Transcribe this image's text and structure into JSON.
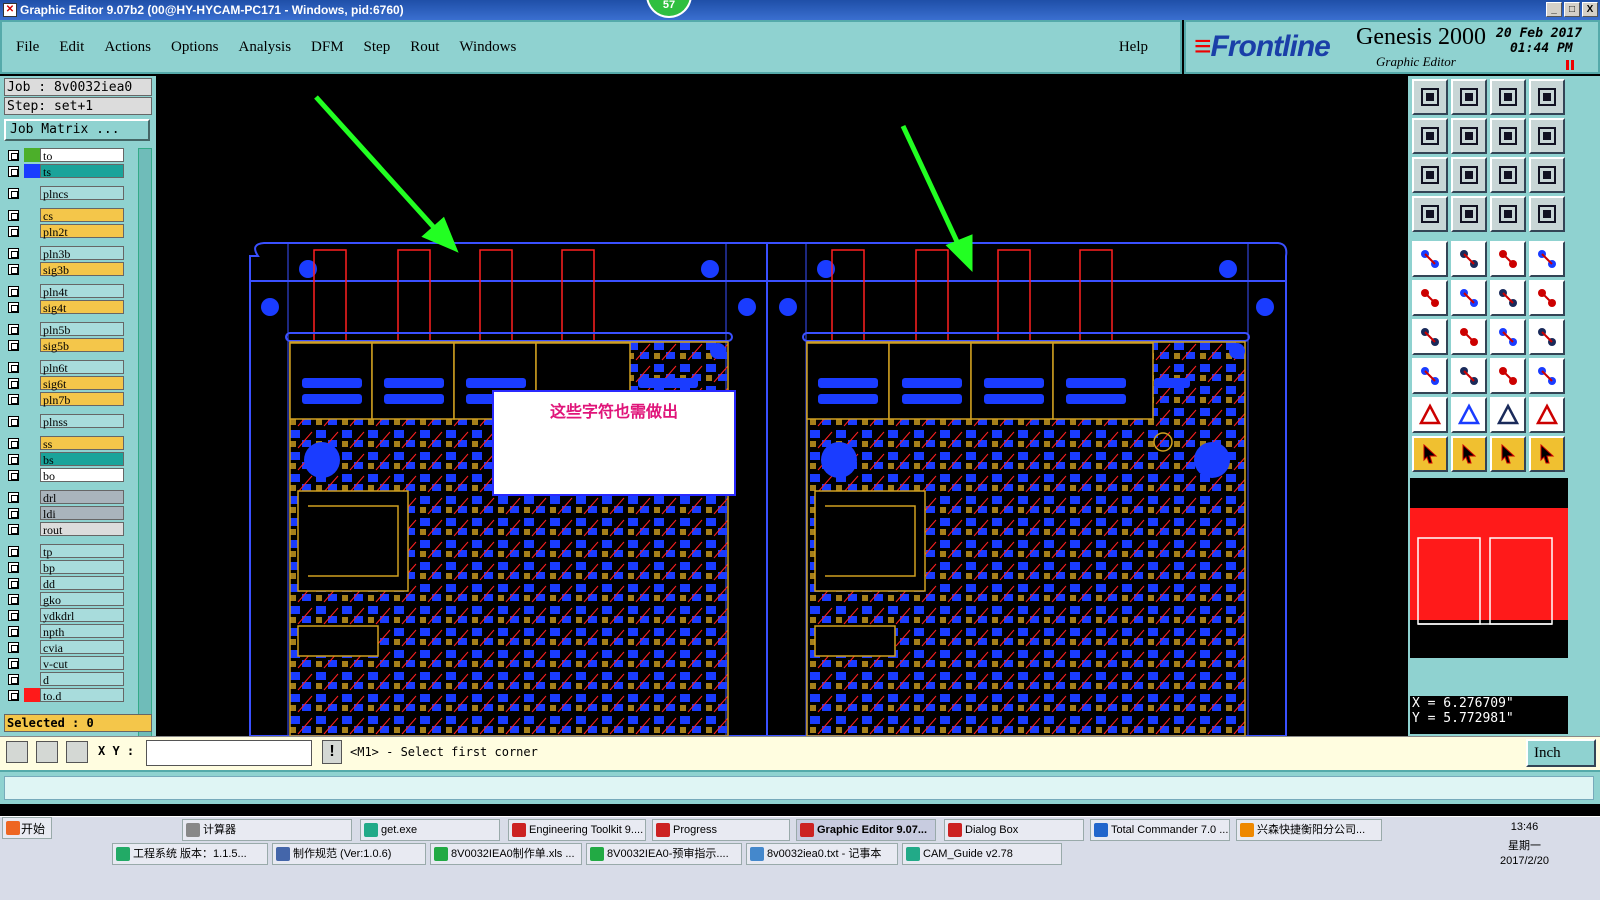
{
  "window": {
    "title": "Graphic Editor 9.07b2 (00@HY-HYCAM-PC171 - Windows, pid:6760)",
    "badge": "57",
    "min_label": "_",
    "max_label": "□",
    "close_label": "X"
  },
  "menu": {
    "items": [
      "File",
      "Edit",
      "Actions",
      "Options",
      "Analysis",
      "DFM",
      "Step",
      "Rout",
      "Windows"
    ],
    "help": "Help"
  },
  "brand": {
    "logo": "Frontline",
    "product": "Genesis 2000",
    "subtitle": "Graphic Editor",
    "date": "20 Feb 2017",
    "time": "01:44 PM"
  },
  "job": {
    "job_label": "Job : 8v0032iea0",
    "step_label": "Step: set+1",
    "matrix_button": "Job Matrix ...",
    "selected": "Selected : 0"
  },
  "layers": [
    {
      "name": "to",
      "swatch": "#4caf2a",
      "bg": "#ffffff"
    },
    {
      "name": "ts",
      "swatch": "#1a3cff",
      "bg": "#1aa39a"
    },
    {
      "name": "plncs",
      "swatch": "#8fd2d0",
      "bg": "#a8dcdc"
    },
    {
      "name": "cs",
      "swatch": "#8fd2d0",
      "bg": "#f4c64a"
    },
    {
      "name": "pln2t",
      "swatch": "#8fd2d0",
      "bg": "#f4c64a"
    },
    {
      "name": "pln3b",
      "swatch": "#8fd2d0",
      "bg": "#a8dcdc"
    },
    {
      "name": "sig3b",
      "swatch": "#8fd2d0",
      "bg": "#f4c64a"
    },
    {
      "name": "pln4t",
      "swatch": "#8fd2d0",
      "bg": "#a8dcdc"
    },
    {
      "name": "sig4t",
      "swatch": "#8fd2d0",
      "bg": "#f4c64a"
    },
    {
      "name": "pln5b",
      "swatch": "#8fd2d0",
      "bg": "#a8dcdc"
    },
    {
      "name": "sig5b",
      "swatch": "#8fd2d0",
      "bg": "#f4c64a"
    },
    {
      "name": "pln6t",
      "swatch": "#8fd2d0",
      "bg": "#a8dcdc"
    },
    {
      "name": "sig6t",
      "swatch": "#8fd2d0",
      "bg": "#f4c64a"
    },
    {
      "name": "pln7b",
      "swatch": "#8fd2d0",
      "bg": "#f4c64a"
    },
    {
      "name": "plnss",
      "swatch": "#8fd2d0",
      "bg": "#a8dcdc"
    },
    {
      "name": "ss",
      "swatch": "#8fd2d0",
      "bg": "#f4c64a"
    },
    {
      "name": "bs",
      "swatch": "#8fd2d0",
      "bg": "#1aa39a"
    },
    {
      "name": "bo",
      "swatch": "#8fd2d0",
      "bg": "#ffffff"
    },
    {
      "name": "drl",
      "swatch": "#8fd2d0",
      "bg": "#a9b4bc"
    },
    {
      "name": "ldi",
      "swatch": "#8fd2d0",
      "bg": "#a9b4bc"
    },
    {
      "name": "rout",
      "swatch": "#8fd2d0",
      "bg": "#dcdcdc"
    },
    {
      "name": "tp",
      "swatch": "#8fd2d0",
      "bg": "#a8dcdc"
    },
    {
      "name": "bp",
      "swatch": "#8fd2d0",
      "bg": "#a8dcdc"
    },
    {
      "name": "dd",
      "swatch": "#8fd2d0",
      "bg": "#a8dcdc"
    },
    {
      "name": "gko",
      "swatch": "#8fd2d0",
      "bg": "#a8dcdc"
    },
    {
      "name": "ydkdrl",
      "swatch": "#8fd2d0",
      "bg": "#a8dcdc"
    },
    {
      "name": "npth",
      "swatch": "#8fd2d0",
      "bg": "#a8dcdc"
    },
    {
      "name": "cvia",
      "swatch": "#8fd2d0",
      "bg": "#a8dcdc"
    },
    {
      "name": "v-cut",
      "swatch": "#8fd2d0",
      "bg": "#a8dcdc"
    },
    {
      "name": "d",
      "swatch": "#8fd2d0",
      "bg": "#a8dcdc"
    },
    {
      "name": "to.d",
      "swatch": "#ff1a1a",
      "bg": "#a8dcdc"
    }
  ],
  "canvas": {
    "annotation": "这些字符也需做出"
  },
  "readout": {
    "x": "X = 6.276709\"",
    "y": "Y = 5.772981\""
  },
  "bottom": {
    "xy_label": "X Y :",
    "xy_value": "",
    "bang": "!",
    "message": "<M1> - Select first corner",
    "unit": "Inch"
  },
  "taskbar": {
    "start": "开始",
    "row1": [
      {
        "label": "计算器",
        "color": "#888"
      },
      {
        "label": "get.exe",
        "color": "#2a8"
      },
      {
        "label": "Engineering Toolkit 9....",
        "color": "#c22"
      },
      {
        "label": "Progress",
        "color": "#c22"
      },
      {
        "label": "Graphic Editor 9.07...",
        "color": "#c22",
        "active": true
      },
      {
        "label": "Dialog Box",
        "color": "#c22"
      },
      {
        "label": "Total Commander 7.0 ...",
        "color": "#26c"
      },
      {
        "label": "兴森快捷衡阳分公司...",
        "color": "#e80"
      }
    ],
    "row2": [
      {
        "label": "工程系统  版本：1.1.5...",
        "color": "#2a6"
      },
      {
        "label": "制作规范 (Ver:1.0.6)",
        "color": "#46a"
      },
      {
        "label": "8V0032IEA0制作单.xls ...",
        "color": "#2a4"
      },
      {
        "label": "8V0032IEA0-预审指示....",
        "color": "#2a4"
      },
      {
        "label": "8v0032iea0.txt - 记事本",
        "color": "#48c"
      },
      {
        "label": "CAM_Guide v2.78",
        "color": "#2a8"
      }
    ],
    "clock": "13:46",
    "weekday": "星期一",
    "date": "2017/2/20"
  }
}
